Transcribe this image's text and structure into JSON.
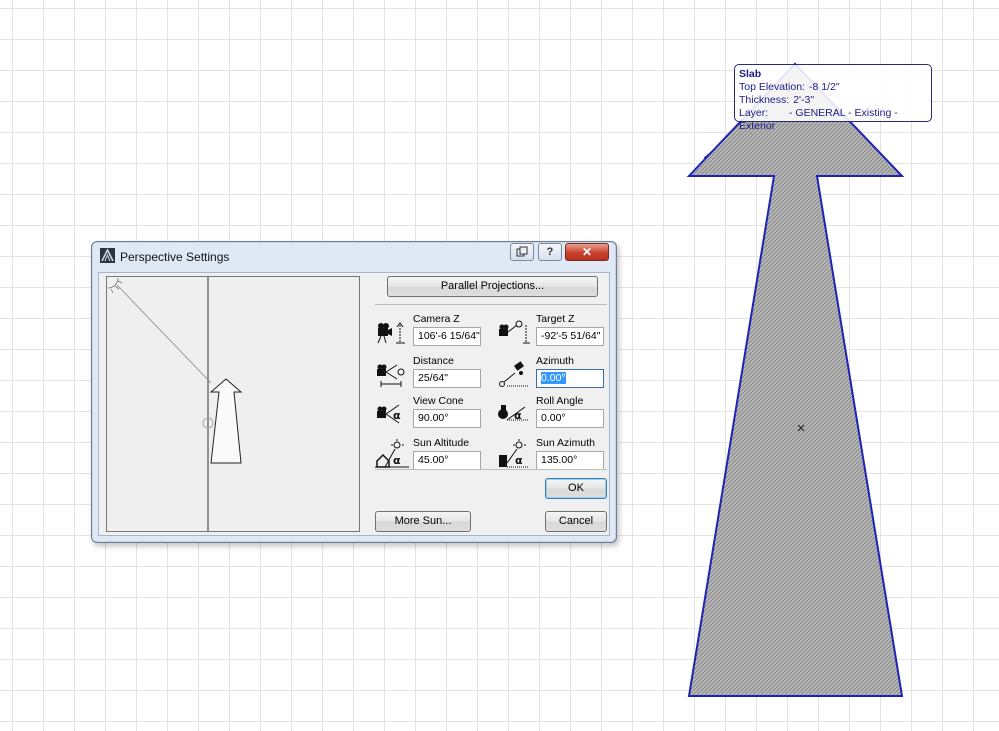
{
  "dialog": {
    "title": "Perspective Settings",
    "help_label": "?",
    "close_label": "✕",
    "parallel_button": "Parallel Projections...",
    "more_sun_button": "More Sun...",
    "ok_button": "OK",
    "cancel_button": "Cancel",
    "fields": {
      "camera_z": {
        "label": "Camera Z",
        "value": "106'-6 15/64\"",
        "icon": "camera-height-icon"
      },
      "target_z": {
        "label": "Target Z",
        "value": "-92'-5 51/64\"",
        "icon": "target-height-icon"
      },
      "distance": {
        "label": "Distance",
        "value": "25/64\"",
        "icon": "camera-distance-icon"
      },
      "azimuth": {
        "label": "Azimuth",
        "value": "0.00°",
        "icon": "azimuth-icon"
      },
      "view_cone": {
        "label": "View Cone",
        "value": "90.00°",
        "icon": "view-cone-icon"
      },
      "roll_angle": {
        "label": "Roll Angle",
        "value": "0.00°",
        "icon": "roll-angle-icon"
      },
      "sun_altitude": {
        "label": "Sun Altitude",
        "value": "45.00°",
        "icon": "sun-altitude-icon"
      },
      "sun_azimuth": {
        "label": "Sun Azimuth",
        "value": "135.00°",
        "icon": "sun-azimuth-icon"
      }
    }
  },
  "tooltip": {
    "title": "Slab",
    "top_elevation_label": "Top Elevation:",
    "top_elevation_value": "-8 1/2\"",
    "thickness_label": "Thickness:",
    "thickness_value": "2'-3\"",
    "layer_label": "Layer:",
    "layer_value": "- GENERAL - Existing - Exterior"
  },
  "colors": {
    "slab_outline": "#1d24b5",
    "slab_fill": "#b8b8b8",
    "tooltip_text": "#1b1b8a",
    "selection_highlight": "#3399ff",
    "close_button": "#c8412c"
  }
}
